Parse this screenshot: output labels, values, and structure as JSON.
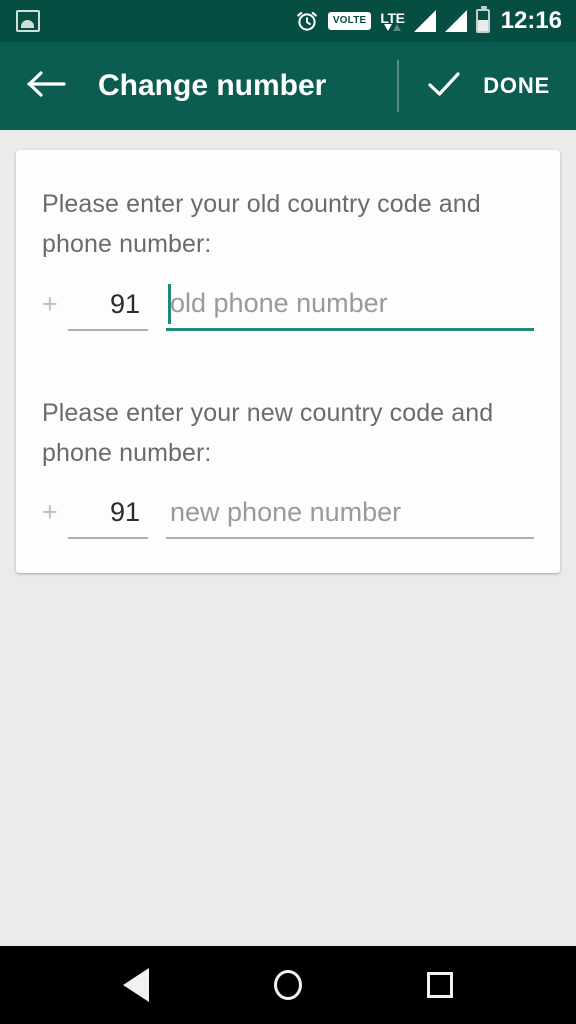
{
  "status_bar": {
    "background": "#064d42",
    "notification_icon": "gallery-icon",
    "alarm_icon": "alarm-clock-icon",
    "volte_label": "VOLTE",
    "lte_label": "LTE",
    "signal_bars": 2,
    "battery_icon": "battery-icon",
    "time": "12:16"
  },
  "app_bar": {
    "background": "#0a5d50",
    "back_icon": "arrow-left-icon",
    "title": "Change number",
    "done_icon": "check-icon",
    "done_label": "DONE"
  },
  "card": {
    "old": {
      "prompt": "Please enter your old country code and phone number:",
      "plus": "+",
      "country_code": "91",
      "placeholder": "old phone number",
      "focused": true,
      "focus_color": "#1f8a7b"
    },
    "new": {
      "prompt": "Please enter your new country code and phone number:",
      "plus": "+",
      "country_code": "91",
      "placeholder": "new phone number",
      "focused": false,
      "underline_color": "#adadad"
    }
  },
  "nav_bar": {
    "background": "#000000",
    "back_label": "back-triangle-icon",
    "home_label": "home-circle-icon",
    "recents_label": "recents-square-icon"
  }
}
